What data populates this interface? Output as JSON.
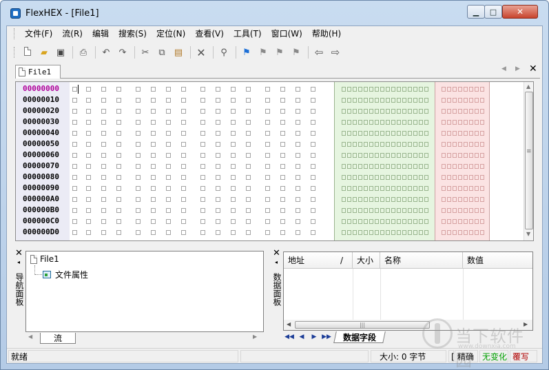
{
  "window": {
    "title": "FlexHEX - [File1]"
  },
  "menu": [
    "文件(F)",
    "流(R)",
    "编辑",
    "搜索(S)",
    "定位(N)",
    "查看(V)",
    "工具(T)",
    "窗口(W)",
    "帮助(H)"
  ],
  "toolbar": {
    "icons": [
      "new-file-icon",
      "open-folder-icon",
      "save-icon",
      "print-icon",
      "undo-icon",
      "redo-icon",
      "cut-icon",
      "copy-icon",
      "paste-icon",
      "delete-icon",
      "find-icon",
      "flag-blue-icon",
      "flag-icon",
      "flag-next-icon",
      "flag-clear-icon",
      "arrow-left-icon",
      "arrow-right-icon"
    ]
  },
  "doc_tab": {
    "label": "File1"
  },
  "hex": {
    "addresses": [
      "00000000",
      "00000010",
      "00000020",
      "00000030",
      "00000040",
      "00000050",
      "00000060",
      "00000070",
      "00000080",
      "00000090",
      "000000A0",
      "000000B0",
      "000000C0",
      "000000D0"
    ]
  },
  "nav_panel": {
    "side_label": "导航面板",
    "root": "File1",
    "child": "文件属性",
    "tab": "流"
  },
  "data_panel": {
    "side_label": "数据面板",
    "columns": [
      "地址",
      "/",
      "大小",
      "名称",
      "数值"
    ],
    "tab": "数据字段"
  },
  "status": {
    "ready": "就绪",
    "size": "大小: 0 字节",
    "cursor": "[",
    "accuracy": "精确",
    "change": "无变化",
    "mode": "覆写"
  },
  "watermark": {
    "text": "当下软件园",
    "url": "www.downxia.com"
  },
  "colors": {
    "address_highlight": "#b0009a",
    "ascii_bg": "#e6f5e0",
    "unicode_bg": "#fbe3e3",
    "status_change": "#00a000",
    "status_mode": "#b00000"
  }
}
